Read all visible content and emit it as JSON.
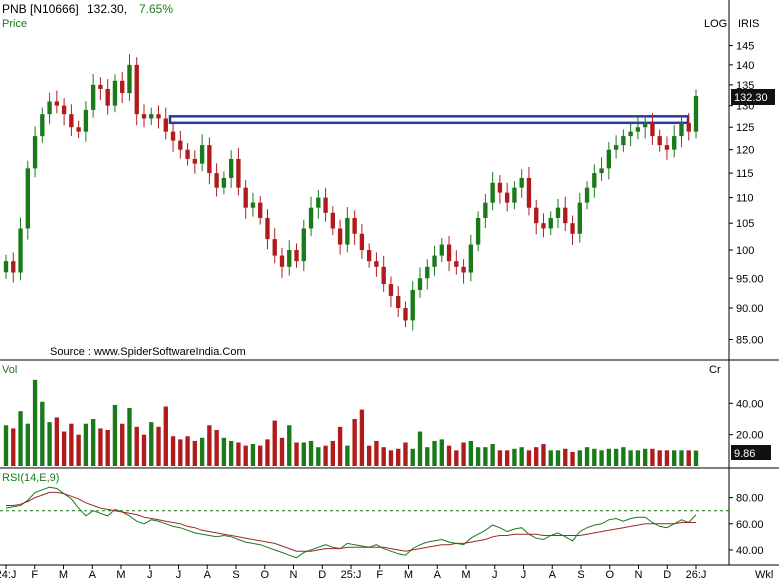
{
  "header": {
    "symbol": "PNB [N10666]",
    "last": "132.30,",
    "change": "7.65%",
    "subtitle": "Price",
    "log_label": "LOG",
    "iris_label": "IRIS"
  },
  "source_text": "Source : www.SpiderSoftwareIndia.Com",
  "price_badge": "132.30",
  "volume": {
    "label": "Vol",
    "unit": "Cr",
    "last_badge": "9.86"
  },
  "rsi": {
    "label": "RSI(14,E,9)"
  },
  "wkl_label": "Wkl",
  "colors": {
    "up": "#1a7a1a",
    "down": "#b01c1c",
    "band": "#2b3a9e",
    "signal": "#9b2a2a",
    "rsi_line": "#1a7a1a"
  },
  "chart_data": [
    {
      "type": "candlestick",
      "title": "PNB [N10666]",
      "ylabel": "Price",
      "y_scale": "log",
      "ylim": [
        84,
        147
      ],
      "yticks": [
        85,
        90,
        95,
        100,
        105,
        110,
        115,
        120,
        125,
        130,
        135,
        140,
        145
      ],
      "x_ticks": [
        "24:J",
        "F",
        "M",
        "A",
        "M",
        "J",
        "J",
        "A",
        "S",
        "O",
        "N",
        "D",
        "25:J",
        "F",
        "M",
        "A",
        "M",
        "J",
        "J",
        "A",
        "S",
        "O",
        "N",
        "D",
        "26:J"
      ],
      "resistance_zone": [
        126,
        127.5
      ],
      "close": [
        98,
        96,
        104,
        116,
        123,
        128,
        131,
        130,
        128,
        125,
        124,
        129,
        135,
        134,
        130,
        136,
        133,
        140,
        128,
        127,
        128,
        127,
        124,
        122,
        120,
        118,
        117,
        121,
        115,
        112,
        114,
        118,
        112,
        108,
        109,
        106,
        102,
        99,
        97,
        100,
        98,
        104,
        108,
        110,
        107,
        104,
        101,
        106,
        103,
        100,
        98,
        97,
        94,
        92,
        90,
        88,
        93,
        95,
        97,
        99,
        101,
        98,
        97,
        96,
        101,
        106,
        109,
        113,
        111,
        109,
        112,
        114,
        108,
        105,
        104,
        106,
        108,
        105,
        103,
        109,
        112,
        115,
        116,
        120,
        121,
        123,
        124,
        125,
        126,
        123,
        121,
        120,
        123,
        126,
        124,
        132.3
      ],
      "last_price": 132.3
    },
    {
      "type": "bar",
      "title": "Vol",
      "unit": "Cr",
      "ylim": [
        0,
        60
      ],
      "yticks": [
        20,
        40
      ],
      "values": [
        26,
        24,
        35,
        27,
        55,
        41,
        28,
        31,
        22,
        27,
        20,
        27,
        30,
        24,
        23,
        39,
        27,
        37,
        25,
        20,
        28,
        25,
        38,
        19,
        17,
        19,
        16,
        18,
        26,
        23,
        18,
        16,
        15,
        13,
        14,
        13,
        17,
        29,
        18,
        26,
        15,
        15,
        16,
        12,
        13,
        16,
        25,
        13,
        30,
        36,
        13,
        16,
        12,
        10,
        11,
        15,
        11,
        22,
        12,
        16,
        17,
        13,
        10,
        15,
        16,
        12,
        12,
        14,
        10,
        10,
        11,
        12,
        10,
        12,
        14,
        10,
        10,
        11,
        9,
        10,
        12,
        11,
        10,
        11,
        11,
        12,
        10,
        10,
        11,
        11,
        10,
        10,
        10,
        10,
        10,
        9.86
      ],
      "last_value": 9.86
    },
    {
      "type": "line",
      "title": "RSI(14,E,9)",
      "ylim": [
        30,
        95
      ],
      "yticks": [
        40,
        60,
        80
      ],
      "reference_line": 70,
      "series": [
        {
          "values": [
            72,
            73,
            74,
            78,
            84,
            86,
            88,
            87,
            83,
            79,
            72,
            66,
            70,
            68,
            66,
            71,
            69,
            66,
            62,
            60,
            63,
            62,
            60,
            58,
            57,
            55,
            53,
            52,
            51,
            50,
            51,
            50,
            48,
            46,
            45,
            44,
            42,
            40,
            38,
            36,
            34,
            38,
            40,
            42,
            44,
            42,
            41,
            45,
            44,
            43,
            42,
            44,
            41,
            39,
            37,
            36,
            41,
            44,
            46,
            47,
            48,
            46,
            45,
            44,
            49,
            52,
            55,
            59,
            57,
            54,
            56,
            57,
            52,
            49,
            48,
            51,
            53,
            50,
            47,
            54,
            57,
            59,
            60,
            63,
            64,
            62,
            64,
            65,
            65,
            61,
            58,
            57,
            60,
            63,
            61,
            67
          ]
        },
        {
          "values": [
            74,
            74,
            75,
            77,
            80,
            82,
            84,
            84,
            83,
            81,
            79,
            76,
            74,
            72,
            71,
            70,
            69,
            68,
            67,
            65,
            64,
            63,
            62,
            61,
            60,
            58,
            57,
            55,
            54,
            53,
            52,
            51,
            50,
            49,
            48,
            47,
            46,
            45,
            43,
            41,
            39,
            39,
            39,
            40,
            41,
            41,
            41,
            42,
            42,
            42,
            42,
            42,
            42,
            41,
            40,
            39,
            40,
            41,
            42,
            43,
            44,
            44,
            45,
            45,
            46,
            47,
            48,
            50,
            51,
            51,
            52,
            52,
            52,
            52,
            51,
            51,
            51,
            51,
            51,
            51,
            52,
            53,
            54,
            55,
            56,
            57,
            58,
            59,
            60,
            60,
            60,
            60,
            60,
            61,
            61,
            61
          ]
        }
      ]
    }
  ]
}
